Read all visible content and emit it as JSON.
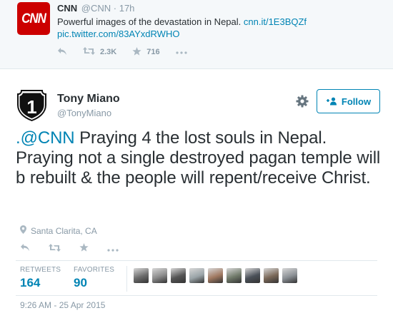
{
  "parent_tweet": {
    "logo_text": "CNN",
    "name": "CNN",
    "handle_time": "@CNN · 17h",
    "text": "Powerful images of the devastation in Nepal.",
    "link1": "cnn.it/1E3BQZf",
    "link2": "pic.twitter.com/83AYxdRWHO",
    "retweets": "2.3K",
    "favorites": "716",
    "brand_color": "#cc0000"
  },
  "tweet": {
    "avatar_text": "1",
    "name": "Tony Miano",
    "handle": "@TonyMiano",
    "follow_label": "Follow",
    "mention": ".@CNN",
    "body": " Praying 4 the lost souls in Nepal. Praying not a single destroyed pagan temple will b rebuilt & the people will repent/receive Christ.",
    "location": "Santa Clarita, CA",
    "stats": {
      "retweets_label": "RETWEETS",
      "retweets_value": "164",
      "favorites_label": "FAVORITES",
      "favorites_value": "90"
    },
    "favoriter_avatars": [
      {
        "name": "favoriter-avatar",
        "color": "#6b6b6b"
      },
      {
        "name": "favoriter-avatar",
        "color": "#8a8a8a"
      },
      {
        "name": "favoriter-avatar",
        "color": "#555555"
      },
      {
        "name": "favoriter-avatar",
        "color": "#9aa4a8"
      },
      {
        "name": "favoriter-avatar",
        "color": "#a07860"
      },
      {
        "name": "favoriter-avatar",
        "color": "#707a6a"
      },
      {
        "name": "favoriter-avatar",
        "color": "#4a5058"
      },
      {
        "name": "favoriter-avatar",
        "color": "#7a6858"
      },
      {
        "name": "favoriter-avatar",
        "color": "#8a8f94"
      }
    ],
    "timestamp": "9:26 AM - 25 Apr 2015"
  },
  "colors": {
    "link": "#0084b4",
    "muted": "#8899a6",
    "text": "#292f33"
  },
  "icons": [
    "reply-icon",
    "retweet-icon",
    "favorite-icon",
    "more-icon",
    "gear-icon",
    "follow-person-icon",
    "location-pin-icon"
  ]
}
